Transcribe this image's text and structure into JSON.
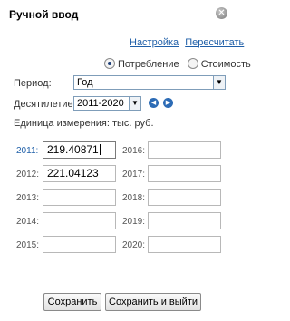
{
  "dialog": {
    "title": "Ручной ввод",
    "close_icon": "close-icon"
  },
  "header_links": {
    "settings": "Настройка",
    "recalc": "Пересчитать"
  },
  "mode": {
    "options": [
      "Потребление",
      "Стоимость"
    ],
    "selected": "Потребление"
  },
  "period": {
    "label": "Период:",
    "value": "Год"
  },
  "decade": {
    "label": "Десятилетие:",
    "value": "2011-2020",
    "prev_icon": "arrow-left-icon",
    "next_icon": "arrow-right-icon"
  },
  "unit": {
    "text": "Единица измерения: тыс. руб."
  },
  "years": {
    "y2011": {
      "label": "2011:",
      "value": "219.40871"
    },
    "y2012": {
      "label": "2012:",
      "value": "221.04123"
    },
    "y2013": {
      "label": "2013:",
      "value": ""
    },
    "y2014": {
      "label": "2014:",
      "value": ""
    },
    "y2015": {
      "label": "2015:",
      "value": ""
    },
    "y2016": {
      "label": "2016:",
      "value": ""
    },
    "y2017": {
      "label": "2017:",
      "value": ""
    },
    "y2018": {
      "label": "2018:",
      "value": ""
    },
    "y2019": {
      "label": "2019:",
      "value": ""
    },
    "y2020": {
      "label": "2020:",
      "value": ""
    }
  },
  "buttons": {
    "save": "Сохранить",
    "save_exit": "Сохранить и выйти"
  }
}
